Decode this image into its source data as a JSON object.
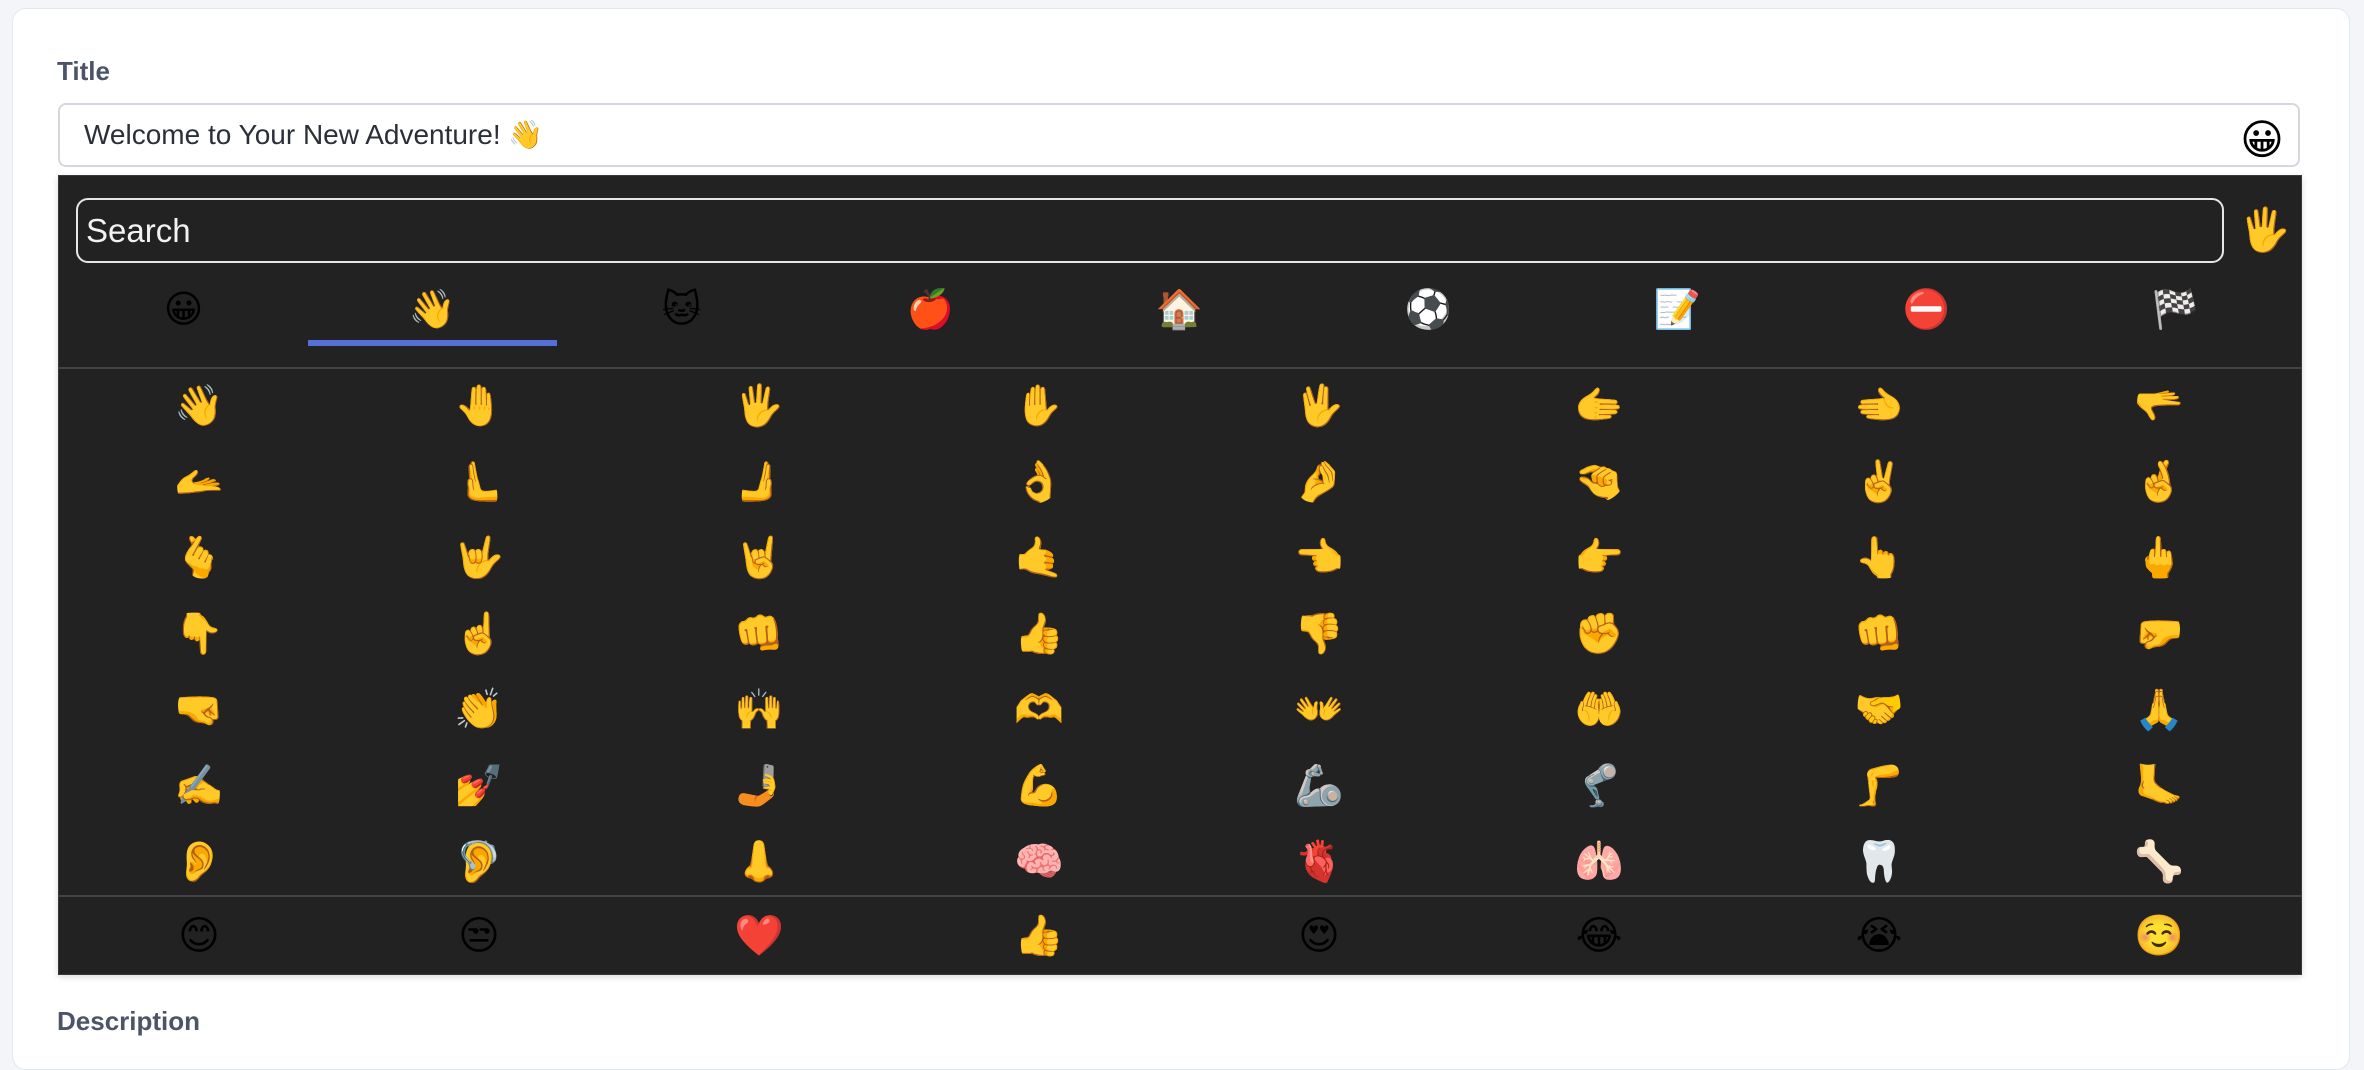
{
  "title_field": {
    "label": "Title",
    "value": "Welcome to Your New Adventure! 👋",
    "emoji_button": "😀"
  },
  "picker": {
    "search_placeholder": "Search",
    "skin_tone": "🖐",
    "tabs": [
      {
        "emoji": "😀",
        "name": "smileys"
      },
      {
        "emoji": "👋",
        "name": "people"
      },
      {
        "emoji": "🐱",
        "name": "animals"
      },
      {
        "emoji": "🍎",
        "name": "food"
      },
      {
        "emoji": "🏠",
        "name": "places"
      },
      {
        "emoji": "⚽",
        "name": "activities"
      },
      {
        "emoji": "📝",
        "name": "objects"
      },
      {
        "emoji": "⛔",
        "name": "symbols"
      },
      {
        "emoji": "🏁",
        "name": "flags"
      }
    ],
    "active_tab": 1,
    "accent_color": "#5470d8",
    "grid": [
      [
        "👋",
        "🤚",
        "🖐",
        "✋",
        "🖖",
        "🫱",
        "🫲",
        "🫳"
      ],
      [
        "🫴",
        "🫷",
        "🫸",
        "👌",
        "🤌",
        "🤏",
        "✌️",
        "🤞"
      ],
      [
        "🫰",
        "🤟",
        "🤘",
        "🤙",
        "👈",
        "👉",
        "👆",
        "🖕"
      ],
      [
        "👇",
        "☝️",
        "👊",
        "👍",
        "👎",
        "✊",
        "👊",
        "🤛"
      ],
      [
        "🤜",
        "👏",
        "🙌",
        "🫶",
        "👐",
        "🤲",
        "🤝",
        "🙏"
      ],
      [
        "✍️",
        "💅",
        "🤳",
        "💪",
        "🦾",
        "🦿",
        "🦵",
        "🦶"
      ],
      [
        "👂",
        "🦻",
        "👃",
        "🧠",
        "🫀",
        "🫁",
        "🦷",
        "🦴"
      ]
    ],
    "frequent": [
      "😊",
      "😒",
      "❤️",
      "👍",
      "😍",
      "😂",
      "😭",
      "☺️"
    ]
  },
  "description_field": {
    "label": "Description"
  }
}
